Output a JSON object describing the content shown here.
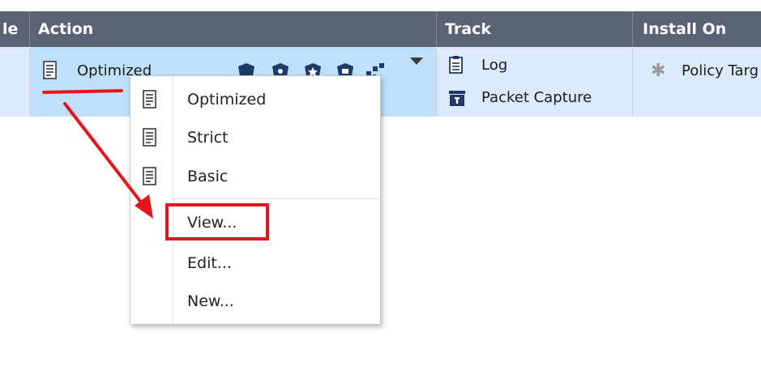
{
  "header": {
    "columns": [
      {
        "label": "le"
      },
      {
        "label": "Action"
      },
      {
        "label": "Track"
      },
      {
        "label": "Install On"
      }
    ]
  },
  "row": {
    "action": {
      "value": "Optimized"
    },
    "track": {
      "items": [
        {
          "label": "Log"
        },
        {
          "label": "Packet Capture"
        }
      ]
    },
    "install_on": {
      "value": "Policy Targ"
    }
  },
  "context_menu": {
    "items": [
      {
        "label": "Optimized"
      },
      {
        "label": "Strict"
      },
      {
        "label": "Basic"
      },
      {
        "label": "View..."
      },
      {
        "label": "Edit..."
      },
      {
        "label": "New..."
      }
    ]
  },
  "colors": {
    "header_bg": "#5a6373",
    "row_bg": "#dcebfb",
    "selected_cell_bg": "#bfe0fa",
    "annotation_red": "#e8141c",
    "icon_navy": "#1f3a67"
  },
  "icons": {
    "profile": "profile-document-icon",
    "shields": "blade-shield-icon",
    "log": "log-clipboard-icon",
    "capture": "packet-capture-icon",
    "target": "asterisk-icon",
    "dropdown": "dropdown-arrow-icon"
  }
}
